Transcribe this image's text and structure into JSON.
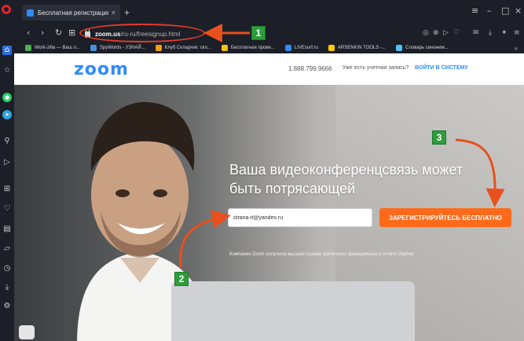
{
  "browser": {
    "tab_title": "Бесплатная регистрация -",
    "tab_close": "×",
    "new_tab": "+",
    "url_host": "zoom.us",
    "url_path": "/ru-ru/freesignup.html",
    "window_controls": [
      "≡",
      "–",
      "□",
      "×"
    ]
  },
  "bookmarks": [
    {
      "label": "Work-zilla — Ваш л...",
      "color": "#4caf50"
    },
    {
      "label": "SpyWords - УЗНАЙ...",
      "color": "#4a90e2"
    },
    {
      "label": "Клуб Складчик: скл...",
      "color": "#f39c12"
    },
    {
      "label": "Бесплатная прове...",
      "color": "#f1c40f"
    },
    {
      "label": "LIVEsurf.ru",
      "color": "#2d8cff"
    },
    {
      "label": "ARSENKIN TOOLS -...",
      "color": "#ffcc00"
    },
    {
      "label": "Словарь синоним...",
      "color": "#4fc3f7"
    }
  ],
  "site": {
    "logo": "zoom",
    "phone": "1.888.799.9666",
    "have_account": "Уже есть учетная запись?",
    "signin": "ВОЙТИ В СИСТЕМУ",
    "hero_line1": "Ваша видеоконференцсвязь может",
    "hero_line2": "быть потрясающей",
    "email_value": "strana-it@yandex.ru",
    "signup_button": "ЗАРЕГИСТРИРУЙТЕСЬ БЕСПЛАТНО",
    "award": "Компания Zoom получила высшие оценки критичного функционала в отчете Gartner"
  },
  "annotations": {
    "badge1": "1",
    "badge2": "2",
    "badge3": "3",
    "arrow_color": "#e8501e",
    "badge_color": "#2e9d3a"
  }
}
